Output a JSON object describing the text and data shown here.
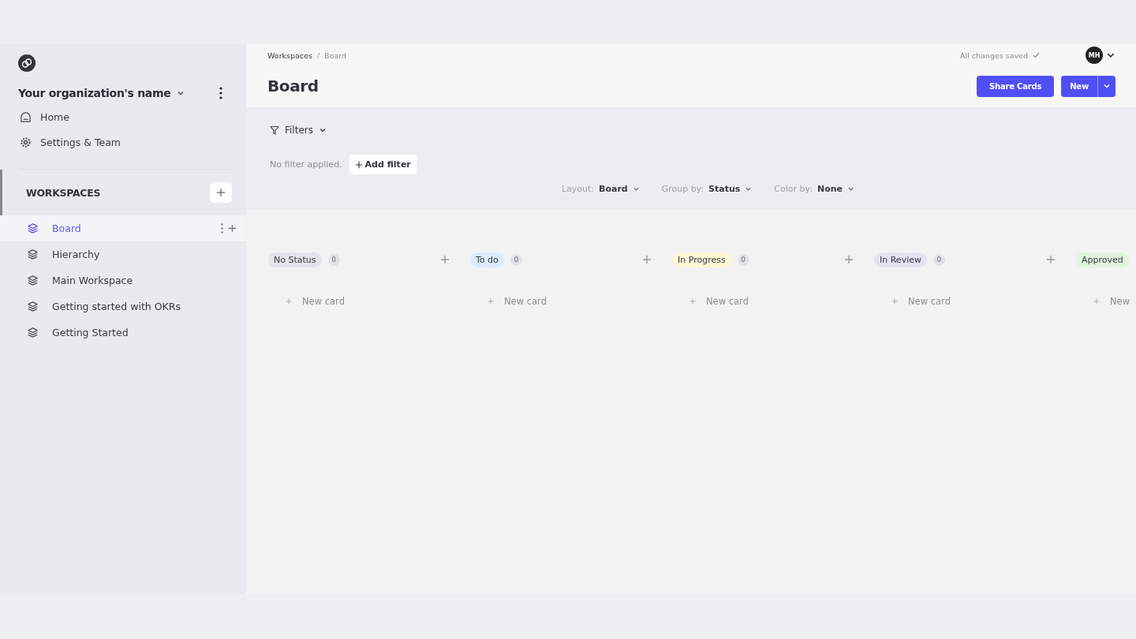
{
  "sidebar": {
    "org_name": "Your organization's name",
    "nav": [
      {
        "kind": "home",
        "label": "Home"
      },
      {
        "kind": "settings",
        "label": "Settings & Team"
      }
    ],
    "section_title": "WORKSPACES",
    "items": [
      {
        "label": "Board",
        "selected": true
      },
      {
        "label": "Hierarchy",
        "selected": false
      },
      {
        "label": "Main Workspace",
        "selected": false
      },
      {
        "label": "Getting started with OKRs",
        "selected": false
      },
      {
        "label": "Getting Started",
        "selected": false
      }
    ]
  },
  "header": {
    "breadcrumbs": [
      {
        "label": "Workspaces",
        "current": false
      },
      {
        "label": "Board",
        "current": true
      }
    ],
    "separator": "/",
    "title": "Board",
    "save_status": "All changes saved",
    "avatar": "MH",
    "buttons": [
      {
        "kind": "primary",
        "label": "Share Cards"
      },
      {
        "kind": "split",
        "label": "New"
      }
    ]
  },
  "filters": {
    "label": "Filters",
    "empty_text": "No filter applied.",
    "add_label": "Add filter",
    "options": [
      {
        "label": "Layout:",
        "value": "Board"
      },
      {
        "label": "Group by:",
        "value": "Status"
      },
      {
        "label": "Color by:",
        "value": "None"
      }
    ]
  },
  "columns": [
    {
      "title": "No Status",
      "color": "#e4e4ea",
      "count": "0",
      "new_card": "New card"
    },
    {
      "title": "To do",
      "color": "#dcebfb",
      "count": "0",
      "new_card": "New card"
    },
    {
      "title": "In Progress",
      "color": "#fbf6d4",
      "count": "0",
      "new_card": "New card"
    },
    {
      "title": "In Review",
      "color": "#e3e3f3",
      "count": "0",
      "new_card": "New card"
    },
    {
      "title": "Approved",
      "color": "#e1f3df",
      "new_card": "New"
    }
  ]
}
